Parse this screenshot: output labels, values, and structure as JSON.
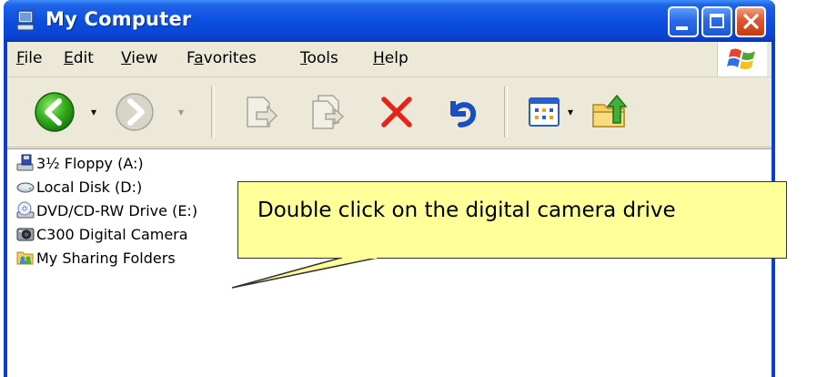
{
  "window": {
    "title": "My Computer",
    "title_icon": "my-computer-icon"
  },
  "menu": [
    {
      "label": "File",
      "underline": "F",
      "rest": "ile"
    },
    {
      "label": "Edit",
      "underline": "E",
      "rest": "dit"
    },
    {
      "label": "View",
      "underline": "V",
      "rest": "iew"
    },
    {
      "label": "Favorites",
      "pre": "F",
      "underline": "a",
      "rest": "vorites"
    },
    {
      "label": "Tools",
      "underline": "T",
      "rest": "ools"
    },
    {
      "label": "Help",
      "underline": "H",
      "rest": "elp"
    }
  ],
  "toolbar": {
    "back": "back-icon",
    "forward": "forward-icon",
    "move_to": "move-to-icon",
    "copy_to": "copy-to-icon",
    "delete": "delete-icon",
    "undo": "undo-icon",
    "views": "views-icon",
    "up": "folder-up-icon"
  },
  "drives": [
    {
      "label": "3½ Floppy (A:)",
      "icon": "floppy-drive-icon"
    },
    {
      "label": "Local Disk (D:)",
      "icon": "hard-disk-icon"
    },
    {
      "label": "DVD/CD-RW Drive (E:)",
      "icon": "dvd-drive-icon"
    },
    {
      "label": "C300 Digital Camera",
      "icon": "camera-icon"
    },
    {
      "label": "My Sharing Folders",
      "icon": "sharing-folder-icon"
    }
  ],
  "callout": {
    "text": "Double click on the digital camera drive"
  },
  "colors": {
    "titlebar": "#0b4fe0",
    "menu_bg": "#ece9d8",
    "callout_bg": "#ffff99",
    "close": "#e05b30"
  }
}
